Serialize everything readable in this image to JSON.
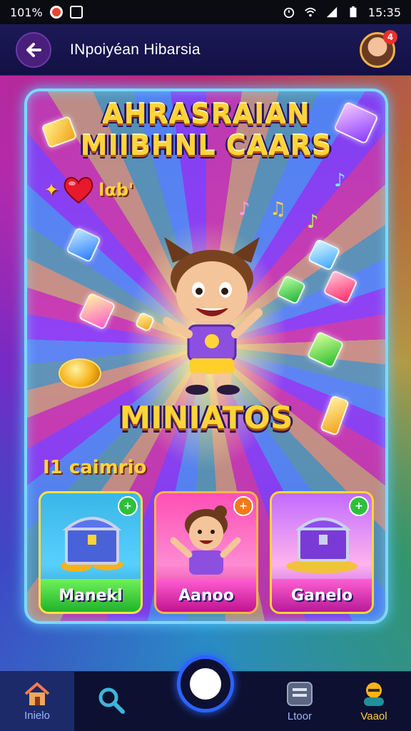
{
  "status_bar": {
    "left_text": "101%",
    "time": "15:35"
  },
  "header": {
    "title": "INpoiyéan Hibarsia",
    "notification_count": "4"
  },
  "game": {
    "title_line1": "AHRASRAIAN",
    "title_line2": "MIIBHNL CAARS",
    "score_text": "lαb'",
    "sub_title": "MINIATOS",
    "section_label": "I1 caimrio"
  },
  "items": [
    {
      "label": "Manekl",
      "icon": "treasure-chest-icon",
      "badge": "+"
    },
    {
      "label": "Aanoo",
      "icon": "character-icon",
      "badge": "+"
    },
    {
      "label": "Ganelo",
      "icon": "treasure-chest-icon",
      "badge": "+"
    }
  ],
  "bottom_nav": {
    "home_label": "Inielo",
    "search_label": "",
    "doc_label": "Ltoor",
    "profile_label": "Vaaol"
  },
  "colors": {
    "accent_gold": "#ffd43a",
    "frame_cyan": "#7fd6ff",
    "nav_blue": "#2a63ff"
  }
}
